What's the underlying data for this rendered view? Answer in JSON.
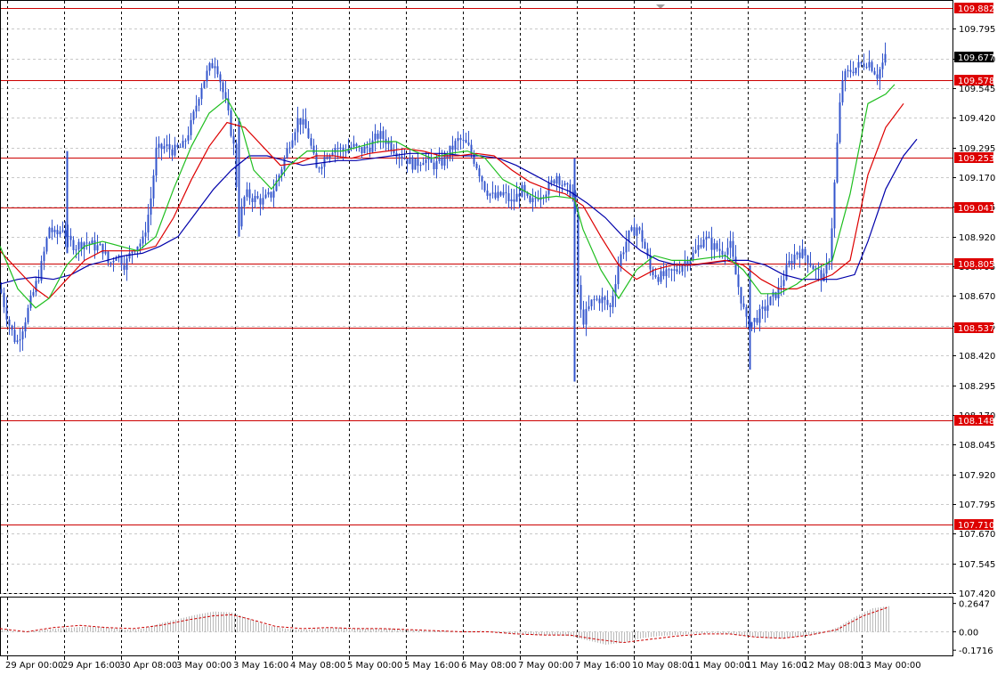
{
  "chart_data": {
    "type": "candlestick",
    "instrument_hint": "",
    "y_range": [
      107.42,
      109.882
    ],
    "y_ticks": [
      "109.795",
      "109.670",
      "109.545",
      "109.420",
      "109.295",
      "109.170",
      "109.045",
      "108.920",
      "108.795",
      "108.670",
      "108.545",
      "108.420",
      "108.295",
      "108.170",
      "108.045",
      "107.920",
      "107.795",
      "107.670",
      "107.545",
      "107.420"
    ],
    "x_labels": [
      "29 Apr 00:00",
      "29 Apr 16:00",
      "30 Apr 08:00",
      "3 May 00:00",
      "3 May 16:00",
      "4 May 08:00",
      "5 May 00:00",
      "5 May 16:00",
      "6 May 08:00",
      "7 May 00:00",
      "7 May 16:00",
      "10 May 08:00",
      "11 May 00:00",
      "11 May 16:00",
      "12 May 08:00",
      "13 May 00:00"
    ],
    "last_price": "109.677",
    "levels": [
      "109.882",
      "109.578",
      "109.253",
      "109.041",
      "108.805",
      "108.537",
      "108.148",
      "107.710"
    ],
    "price_path": [
      [
        0,
        108.7
      ],
      [
        5,
        108.62
      ],
      [
        10,
        108.55
      ],
      [
        18,
        108.47
      ],
      [
        26,
        108.55
      ],
      [
        35,
        108.66
      ],
      [
        45,
        108.78
      ],
      [
        55,
        108.96
      ],
      [
        62,
        108.92
      ],
      [
        70,
        108.96
      ],
      [
        76,
        108.9
      ],
      [
        85,
        108.88
      ],
      [
        95,
        108.9
      ],
      [
        105,
        108.88
      ],
      [
        115,
        108.87
      ],
      [
        122,
        108.8
      ],
      [
        130,
        108.85
      ],
      [
        140,
        108.8
      ],
      [
        150,
        108.88
      ],
      [
        160,
        108.9
      ],
      [
        168,
        109.05
      ],
      [
        175,
        109.28
      ],
      [
        185,
        109.3
      ],
      [
        195,
        109.28
      ],
      [
        205,
        109.3
      ],
      [
        215,
        109.4
      ],
      [
        225,
        109.55
      ],
      [
        235,
        109.63
      ],
      [
        242,
        109.66
      ],
      [
        248,
        109.56
      ],
      [
        255,
        109.45
      ],
      [
        262,
        109.3
      ],
      [
        268,
        108.98
      ],
      [
        275,
        109.1
      ],
      [
        285,
        109.08
      ],
      [
        295,
        109.07
      ],
      [
        305,
        109.1
      ],
      [
        315,
        109.2
      ],
      [
        325,
        109.32
      ],
      [
        335,
        109.42
      ],
      [
        345,
        109.36
      ],
      [
        355,
        109.2
      ],
      [
        365,
        109.26
      ],
      [
        375,
        109.3
      ],
      [
        385,
        109.28
      ],
      [
        395,
        109.3
      ],
      [
        405,
        109.28
      ],
      [
        415,
        109.3
      ],
      [
        425,
        109.35
      ],
      [
        435,
        109.32
      ],
      [
        445,
        109.28
      ],
      [
        455,
        109.25
      ],
      [
        465,
        109.22
      ],
      [
        475,
        109.25
      ],
      [
        485,
        109.22
      ],
      [
        495,
        109.23
      ],
      [
        505,
        109.28
      ],
      [
        515,
        109.33
      ],
      [
        525,
        109.3
      ],
      [
        535,
        109.22
      ],
      [
        545,
        109.12
      ],
      [
        555,
        109.08
      ],
      [
        565,
        109.1
      ],
      [
        575,
        109.06
      ],
      [
        585,
        109.12
      ],
      [
        595,
        109.05
      ],
      [
        605,
        109.1
      ],
      [
        615,
        109.12
      ],
      [
        625,
        109.18
      ],
      [
        635,
        109.12
      ],
      [
        645,
        109.1
      ],
      [
        650,
        108.62
      ],
      [
        655,
        108.57
      ],
      [
        665,
        108.65
      ],
      [
        675,
        108.66
      ],
      [
        685,
        108.62
      ],
      [
        695,
        108.82
      ],
      [
        705,
        108.92
      ],
      [
        715,
        108.96
      ],
      [
        722,
        108.9
      ],
      [
        730,
        108.78
      ],
      [
        740,
        108.75
      ],
      [
        750,
        108.76
      ],
      [
        760,
        108.78
      ],
      [
        770,
        108.82
      ],
      [
        780,
        108.85
      ],
      [
        790,
        108.92
      ],
      [
        800,
        108.88
      ],
      [
        810,
        108.86
      ],
      [
        820,
        108.88
      ],
      [
        826,
        108.76
      ],
      [
        832,
        108.66
      ],
      [
        838,
        108.56
      ],
      [
        845,
        108.56
      ],
      [
        855,
        108.6
      ],
      [
        865,
        108.65
      ],
      [
        875,
        108.7
      ],
      [
        885,
        108.8
      ],
      [
        895,
        108.86
      ],
      [
        905,
        108.84
      ],
      [
        915,
        108.78
      ],
      [
        925,
        108.74
      ],
      [
        932,
        108.85
      ],
      [
        938,
        109.2
      ],
      [
        945,
        109.58
      ],
      [
        955,
        109.62
      ],
      [
        965,
        109.64
      ],
      [
        975,
        109.66
      ],
      [
        985,
        109.6
      ],
      [
        995,
        109.68
      ]
    ],
    "ma_fast": [
      [
        0,
        108.88
      ],
      [
        20,
        108.7
      ],
      [
        40,
        108.62
      ],
      [
        55,
        108.66
      ],
      [
        75,
        108.8
      ],
      [
        95,
        108.88
      ],
      [
        115,
        108.9
      ],
      [
        135,
        108.88
      ],
      [
        155,
        108.86
      ],
      [
        175,
        108.92
      ],
      [
        195,
        109.12
      ],
      [
        215,
        109.3
      ],
      [
        235,
        109.44
      ],
      [
        255,
        109.5
      ],
      [
        270,
        109.4
      ],
      [
        285,
        109.2
      ],
      [
        305,
        109.12
      ],
      [
        325,
        109.22
      ],
      [
        345,
        109.28
      ],
      [
        365,
        109.28
      ],
      [
        385,
        109.28
      ],
      [
        405,
        109.3
      ],
      [
        425,
        109.32
      ],
      [
        445,
        109.32
      ],
      [
        465,
        109.28
      ],
      [
        485,
        109.25
      ],
      [
        505,
        109.27
      ],
      [
        525,
        109.28
      ],
      [
        545,
        109.25
      ],
      [
        565,
        109.16
      ],
      [
        585,
        109.12
      ],
      [
        605,
        109.08
      ],
      [
        625,
        109.09
      ],
      [
        645,
        109.08
      ],
      [
        655,
        108.95
      ],
      [
        675,
        108.78
      ],
      [
        695,
        108.66
      ],
      [
        715,
        108.78
      ],
      [
        735,
        108.84
      ],
      [
        755,
        108.82
      ],
      [
        775,
        108.82
      ],
      [
        795,
        108.83
      ],
      [
        815,
        108.84
      ],
      [
        835,
        108.78
      ],
      [
        855,
        108.68
      ],
      [
        875,
        108.68
      ],
      [
        895,
        108.72
      ],
      [
        915,
        108.78
      ],
      [
        935,
        108.82
      ],
      [
        955,
        109.1
      ],
      [
        975,
        109.48
      ],
      [
        995,
        109.52
      ],
      [
        1005,
        109.56
      ]
    ],
    "ma_mid": [
      [
        0,
        108.86
      ],
      [
        20,
        108.78
      ],
      [
        40,
        108.7
      ],
      [
        55,
        108.66
      ],
      [
        75,
        108.74
      ],
      [
        95,
        108.82
      ],
      [
        115,
        108.86
      ],
      [
        135,
        108.86
      ],
      [
        155,
        108.86
      ],
      [
        175,
        108.88
      ],
      [
        195,
        109.0
      ],
      [
        215,
        109.16
      ],
      [
        235,
        109.3
      ],
      [
        255,
        109.4
      ],
      [
        275,
        109.38
      ],
      [
        295,
        109.3
      ],
      [
        315,
        109.22
      ],
      [
        335,
        109.23
      ],
      [
        355,
        109.26
      ],
      [
        375,
        109.26
      ],
      [
        395,
        109.25
      ],
      [
        415,
        109.27
      ],
      [
        435,
        109.28
      ],
      [
        455,
        109.29
      ],
      [
        475,
        109.28
      ],
      [
        495,
        109.26
      ],
      [
        515,
        109.26
      ],
      [
        535,
        109.27
      ],
      [
        555,
        109.26
      ],
      [
        575,
        109.2
      ],
      [
        595,
        109.15
      ],
      [
        615,
        109.12
      ],
      [
        635,
        109.1
      ],
      [
        655,
        109.05
      ],
      [
        675,
        108.92
      ],
      [
        695,
        108.8
      ],
      [
        715,
        108.74
      ],
      [
        735,
        108.78
      ],
      [
        755,
        108.8
      ],
      [
        775,
        108.8
      ],
      [
        795,
        108.81
      ],
      [
        815,
        108.82
      ],
      [
        835,
        108.8
      ],
      [
        855,
        108.74
      ],
      [
        875,
        108.7
      ],
      [
        895,
        108.7
      ],
      [
        915,
        108.73
      ],
      [
        935,
        108.76
      ],
      [
        955,
        108.82
      ],
      [
        975,
        109.18
      ],
      [
        995,
        109.38
      ],
      [
        1015,
        109.48
      ]
    ],
    "ma_slow": [
      [
        0,
        108.72
      ],
      [
        20,
        108.74
      ],
      [
        40,
        108.75
      ],
      [
        60,
        108.74
      ],
      [
        80,
        108.76
      ],
      [
        100,
        108.8
      ],
      [
        120,
        108.82
      ],
      [
        140,
        108.84
      ],
      [
        160,
        108.85
      ],
      [
        180,
        108.88
      ],
      [
        200,
        108.92
      ],
      [
        220,
        109.02
      ],
      [
        240,
        109.12
      ],
      [
        260,
        109.2
      ],
      [
        280,
        109.26
      ],
      [
        300,
        109.26
      ],
      [
        320,
        109.24
      ],
      [
        340,
        109.22
      ],
      [
        360,
        109.23
      ],
      [
        380,
        109.24
      ],
      [
        400,
        109.24
      ],
      [
        420,
        109.25
      ],
      [
        440,
        109.26
      ],
      [
        460,
        109.27
      ],
      [
        480,
        109.27
      ],
      [
        500,
        109.27
      ],
      [
        520,
        109.26
      ],
      [
        540,
        109.26
      ],
      [
        560,
        109.25
      ],
      [
        580,
        109.22
      ],
      [
        600,
        109.18
      ],
      [
        620,
        109.14
      ],
      [
        640,
        109.11
      ],
      [
        660,
        109.06
      ],
      [
        680,
        109.0
      ],
      [
        700,
        108.92
      ],
      [
        720,
        108.86
      ],
      [
        740,
        108.82
      ],
      [
        760,
        108.8
      ],
      [
        780,
        108.8
      ],
      [
        800,
        108.81
      ],
      [
        820,
        108.82
      ],
      [
        840,
        108.82
      ],
      [
        860,
        108.8
      ],
      [
        880,
        108.76
      ],
      [
        900,
        108.74
      ],
      [
        920,
        108.74
      ],
      [
        940,
        108.74
      ],
      [
        960,
        108.76
      ],
      [
        975,
        108.9
      ],
      [
        995,
        109.12
      ],
      [
        1015,
        109.26
      ],
      [
        1030,
        109.33
      ]
    ],
    "oscillator": {
      "ticks": [
        "0.2647",
        "0.00",
        "-0.1716"
      ],
      "range": [
        -0.22,
        0.32
      ],
      "histogram": [
        [
          0,
          0.02
        ],
        [
          20,
          0.0
        ],
        [
          40,
          0.01
        ],
        [
          60,
          0.03
        ],
        [
          80,
          0.04
        ],
        [
          100,
          0.05
        ],
        [
          120,
          0.04
        ],
        [
          140,
          0.02
        ],
        [
          160,
          0.03
        ],
        [
          180,
          0.08
        ],
        [
          200,
          0.12
        ],
        [
          220,
          0.16
        ],
        [
          240,
          0.19
        ],
        [
          260,
          0.18
        ],
        [
          280,
          0.12
        ],
        [
          300,
          0.06
        ],
        [
          320,
          0.03
        ],
        [
          340,
          0.02
        ],
        [
          360,
          0.03
        ],
        [
          380,
          0.04
        ],
        [
          400,
          0.03
        ],
        [
          420,
          0.03
        ],
        [
          440,
          0.03
        ],
        [
          460,
          0.02
        ],
        [
          480,
          0.01
        ],
        [
          500,
          0.01
        ],
        [
          520,
          0.0
        ],
        [
          540,
          0.01
        ],
        [
          560,
          -0.01
        ],
        [
          580,
          -0.02
        ],
        [
          600,
          -0.03
        ],
        [
          620,
          -0.03
        ],
        [
          640,
          -0.04
        ],
        [
          660,
          -0.08
        ],
        [
          680,
          -0.12
        ],
        [
          700,
          -0.1
        ],
        [
          720,
          -0.06
        ],
        [
          740,
          -0.04
        ],
        [
          760,
          -0.03
        ],
        [
          780,
          -0.02
        ],
        [
          800,
          -0.01
        ],
        [
          820,
          -0.02
        ],
        [
          840,
          -0.04
        ],
        [
          860,
          -0.06
        ],
        [
          880,
          -0.06
        ],
        [
          900,
          -0.04
        ],
        [
          920,
          -0.02
        ],
        [
          940,
          0.04
        ],
        [
          960,
          0.14
        ],
        [
          980,
          0.22
        ],
        [
          998,
          0.24
        ]
      ],
      "signal": [
        [
          0,
          0.03
        ],
        [
          30,
          0.0
        ],
        [
          60,
          0.04
        ],
        [
          90,
          0.06
        ],
        [
          120,
          0.04
        ],
        [
          150,
          0.03
        ],
        [
          180,
          0.06
        ],
        [
          210,
          0.11
        ],
        [
          240,
          0.15
        ],
        [
          260,
          0.16
        ],
        [
          280,
          0.12
        ],
        [
          310,
          0.05
        ],
        [
          340,
          0.03
        ],
        [
          370,
          0.04
        ],
        [
          400,
          0.03
        ],
        [
          430,
          0.03
        ],
        [
          460,
          0.02
        ],
        [
          490,
          0.01
        ],
        [
          520,
          0.0
        ],
        [
          550,
          0.0
        ],
        [
          580,
          -0.02
        ],
        [
          610,
          -0.03
        ],
        [
          640,
          -0.03
        ],
        [
          670,
          -0.07
        ],
        [
          700,
          -0.1
        ],
        [
          730,
          -0.07
        ],
        [
          760,
          -0.04
        ],
        [
          790,
          -0.02
        ],
        [
          820,
          -0.02
        ],
        [
          850,
          -0.05
        ],
        [
          880,
          -0.06
        ],
        [
          910,
          -0.03
        ],
        [
          940,
          0.02
        ],
        [
          970,
          0.15
        ],
        [
          998,
          0.23
        ]
      ]
    }
  },
  "colors": {
    "candle": "#3355cc",
    "ma_fast": "#1ebe1e",
    "ma_mid": "#dd0000",
    "ma_slow": "#0000aa",
    "level_line": "#cc0000",
    "level_tag": "#dd0000",
    "last_tag": "#000000",
    "grid": "#000000",
    "histogram": "#bbbbbb",
    "signal": "#cc0000"
  }
}
